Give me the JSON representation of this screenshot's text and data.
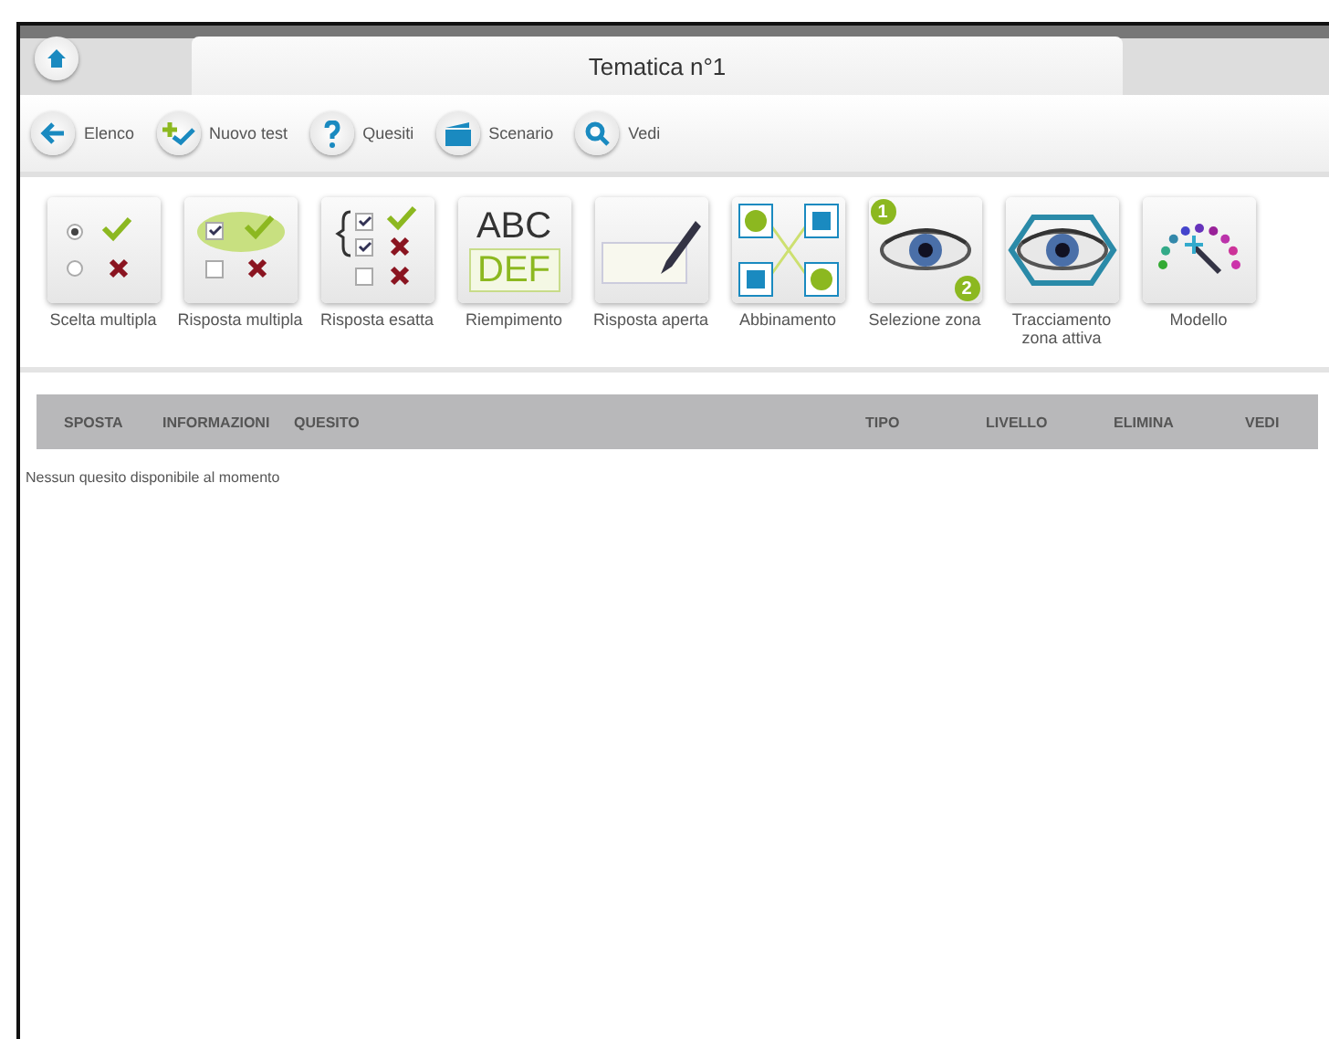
{
  "window": {
    "title": "Tematica n°1"
  },
  "toolbar": [
    {
      "kind": "back",
      "label": "Elenco"
    },
    {
      "kind": "new",
      "label": "Nuovo test"
    },
    {
      "kind": "question",
      "label": "Quesiti"
    },
    {
      "kind": "scene",
      "label": "Scenario"
    },
    {
      "kind": "search",
      "label": "Vedi"
    }
  ],
  "question_types": [
    {
      "kind": "single",
      "label": "Scelta multipla"
    },
    {
      "kind": "multi",
      "label": "Risposta multipla"
    },
    {
      "kind": "exact",
      "label": "Risposta esatta"
    },
    {
      "kind": "fill",
      "label": "Riempimento",
      "text_top": "ABC",
      "text_bottom": "DEF"
    },
    {
      "kind": "open",
      "label": "Risposta aperta"
    },
    {
      "kind": "match",
      "label": "Abbinamento"
    },
    {
      "kind": "zone",
      "label": "Selezione zona",
      "badge_1": "1",
      "badge_2": "2"
    },
    {
      "kind": "trace",
      "label": "Tracciamento zona attiva"
    },
    {
      "kind": "model",
      "label": "Modello"
    }
  ],
  "table": {
    "columns": [
      "SPOSTA",
      "INFORMAZIONI",
      "QUESITO",
      "TIPO",
      "LIVELLO",
      "ELIMINA",
      "VEDI"
    ],
    "empty_message": "Nessun quesito disponibile al momento"
  }
}
